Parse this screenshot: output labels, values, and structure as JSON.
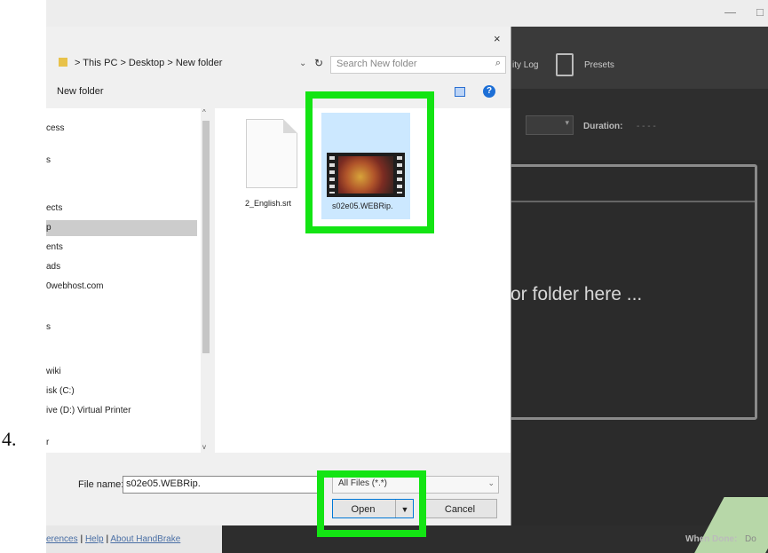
{
  "step_number": "4.",
  "colors": {
    "highlight": "#13e413",
    "selection": "#cce8ff",
    "accent": "#0078d7"
  },
  "handbrake": {
    "window_buttons": {
      "minimize": "—",
      "maximize": "□"
    },
    "toolbar": {
      "activity_log": "ity Log",
      "presets": "Presets"
    },
    "duration_label": "Duration:",
    "duration_value": "- - - -",
    "drop_text": "or folder here ...",
    "when_done_label": "When Done:",
    "when_done_value": "Do",
    "footer_links": [
      "erences",
      "Help",
      "About HandBrake"
    ],
    "footer_sep": "|"
  },
  "dialog": {
    "close": "×",
    "nav_up": "↑",
    "breadcrumb": "> This PC > Desktop > New folder",
    "breadcrumb_chevron": "⌄",
    "refresh": "↻",
    "search_placeholder": "Search New folder",
    "search_icon": "⌕",
    "new_folder": "New folder",
    "help": "?",
    "nav_items": [
      "cess",
      "s",
      "ects",
      "p",
      "ents",
      "ads",
      "0webhost.com",
      "s",
      "wiki",
      "isk (C:)",
      "ive (D:) Virtual Printer",
      "r  "
    ],
    "scroll_up": "^",
    "scroll_down": "v",
    "files": [
      {
        "name": "2_English.srt",
        "icon": "document-icon"
      },
      {
        "name": "s02e05.WEBRip.",
        "icon": "video-file-icon",
        "selected": true
      }
    ],
    "file_name_label": "File name:",
    "file_name_value": "s02e05.WEBRip.",
    "filter_value": "All Files (*.*)",
    "filter_chevron": "⌄",
    "open_label": "Open",
    "open_dropdown": "▼",
    "cancel_label": "Cancel"
  }
}
